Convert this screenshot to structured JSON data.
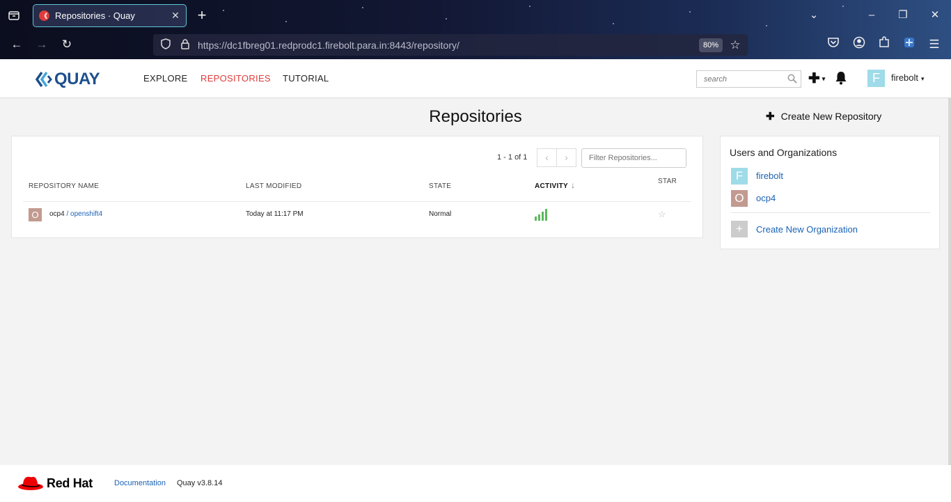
{
  "browser": {
    "tab_title": "Repositories · Quay",
    "favicon_glyph": "《",
    "url": "https://dc1fbreg01.redprodc1.firebolt.para.in:8443/repository/",
    "zoom": "80%"
  },
  "header": {
    "logo_text": "QUAY",
    "nav": [
      {
        "label": "EXPLORE"
      },
      {
        "label": "REPOSITORIES"
      },
      {
        "label": "TUTORIAL"
      }
    ],
    "search_placeholder": "search",
    "user_initial": "F",
    "username": "firebolt"
  },
  "main": {
    "title": "Repositories",
    "create_repo_label": "Create New Repository",
    "pager_text": "1 - 1 of 1",
    "filter_placeholder": "Filter Repositories...",
    "columns": {
      "name": "REPOSITORY NAME",
      "modified": "LAST MODIFIED",
      "state": "STATE",
      "activity": "ACTIVITY",
      "star": "STAR"
    },
    "rows": [
      {
        "avatar_initial": "O",
        "namespace": "ocp4",
        "separator": " / ",
        "name": "openshift4",
        "last_modified": "Today at 11:17 PM",
        "state": "Normal"
      }
    ]
  },
  "orgs": {
    "title": "Users and Organizations",
    "items": [
      {
        "initial": "F",
        "name": "firebolt",
        "color": "#9fdbe8"
      },
      {
        "initial": "O",
        "name": "ocp4",
        "color": "#c29a90"
      }
    ],
    "create_label": "Create New Organization"
  },
  "footer": {
    "brand": "Red Hat",
    "documentation": "Documentation",
    "version": "Quay v3.8.14"
  },
  "colors": {
    "accent_red": "#e03b3b",
    "link_blue": "#1a62b4",
    "activity_green": "#5cb85c"
  }
}
